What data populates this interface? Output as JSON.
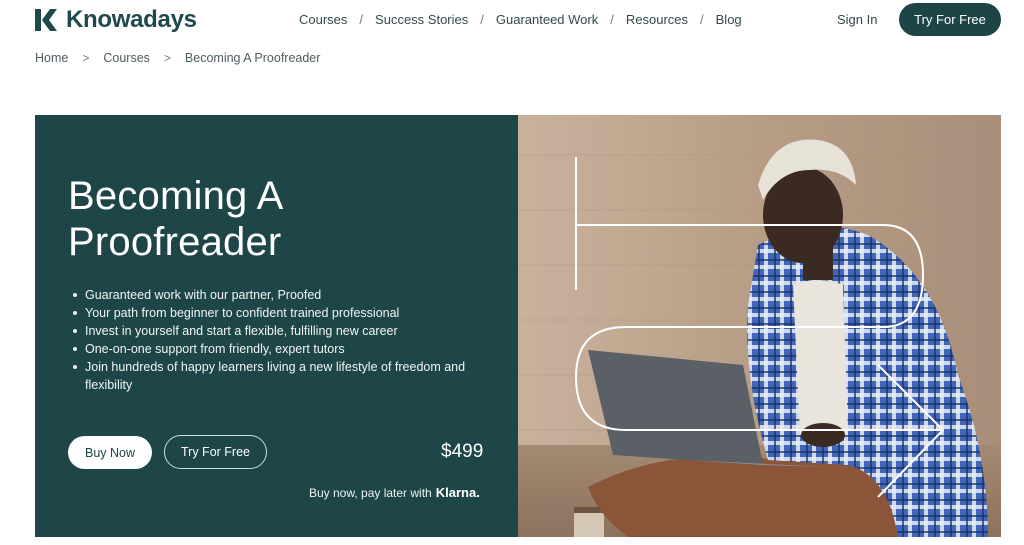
{
  "brand": {
    "name": "Knowadays"
  },
  "nav": {
    "items": [
      "Courses",
      "Success Stories",
      "Guaranteed Work",
      "Resources",
      "Blog"
    ],
    "separator": "/"
  },
  "header": {
    "sign_in": "Sign In",
    "try_free": "Try For Free"
  },
  "breadcrumb": {
    "items": [
      "Home",
      "Courses",
      "Becoming A Proofreader"
    ],
    "separator": ">"
  },
  "hero": {
    "title_line1": "Becoming A",
    "title_line2": "Proofreader",
    "bullets": [
      "Guaranteed work with our partner, Proofed",
      "Your path from beginner to confident trained professional",
      "Invest in yourself and start a flexible, fulfilling new career",
      "One-on-one support from friendly, expert tutors",
      "Join hundreds of happy learners living a new lifestyle of freedom and flexibility"
    ],
    "buy_now": "Buy Now",
    "try_free": "Try For Free",
    "price": "$499",
    "pay_later": "Buy now, pay later with",
    "klarna": "Klarna."
  },
  "colors": {
    "primary": "#1e4547",
    "accent": "#ffffff"
  }
}
